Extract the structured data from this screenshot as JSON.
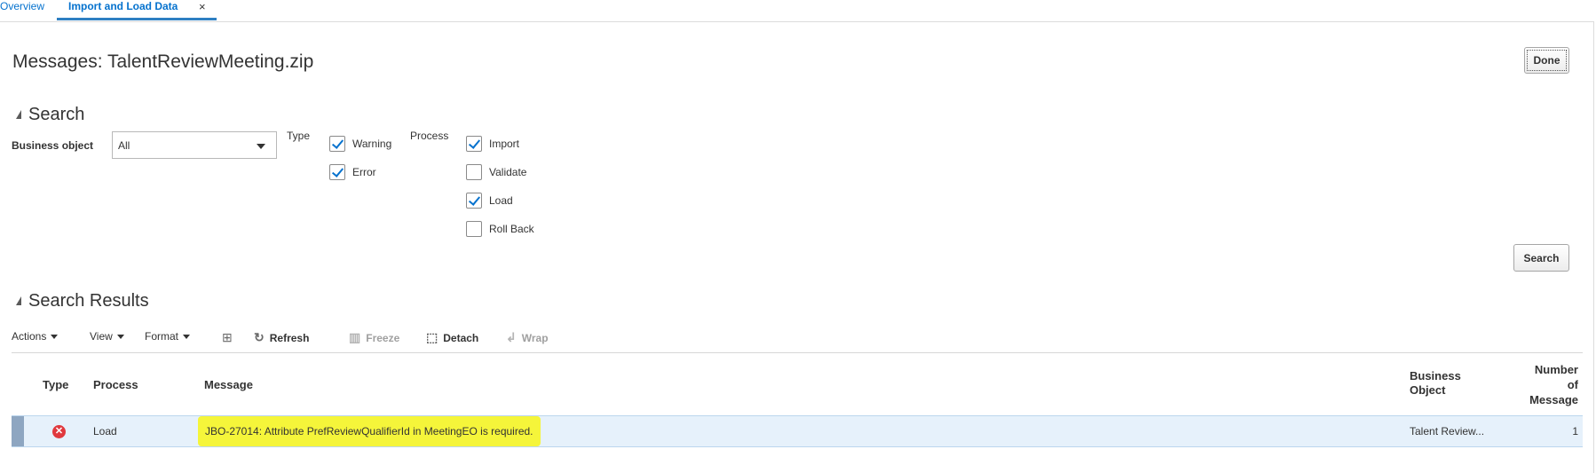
{
  "tabs": {
    "overview": "Overview",
    "active": "Import and Load Data",
    "close": "×"
  },
  "header": {
    "title": "Messages: TalentReviewMeeting.zip",
    "done_button": "Done"
  },
  "search": {
    "heading": "Search",
    "business_object_label": "Business object",
    "business_object_value": "All",
    "type_label": "Type",
    "type_options": [
      {
        "label": "Warning",
        "checked": true
      },
      {
        "label": "Error",
        "checked": true
      }
    ],
    "process_label": "Process",
    "process_options": [
      {
        "label": "Import",
        "checked": true
      },
      {
        "label": "Validate",
        "checked": false
      },
      {
        "label": "Load",
        "checked": true
      },
      {
        "label": "Roll Back",
        "checked": false
      }
    ],
    "search_button": "Search"
  },
  "results": {
    "heading": "Search Results",
    "toolbar": {
      "actions": "Actions",
      "view": "View",
      "format": "Format",
      "refresh": "Refresh",
      "freeze": "Freeze",
      "detach": "Detach",
      "wrap": "Wrap"
    },
    "columns": {
      "type": "Type",
      "process": "Process",
      "message": "Message",
      "business_object_1": "Business",
      "business_object_2": "Object",
      "number_1": "Number",
      "number_2": "of",
      "number_3": "Message"
    },
    "rows": [
      {
        "type_icon": "error-icon",
        "process": "Load",
        "message": "JBO-27014: Attribute PrefReviewQualifierId in MeetingEO is required.",
        "business_object": "Talent Review...",
        "number": "1"
      }
    ]
  },
  "colors": {
    "link": "#0572ce",
    "highlight": "#f5f53a",
    "error": "#e0393e",
    "row_selected": "#e6f1fb"
  }
}
